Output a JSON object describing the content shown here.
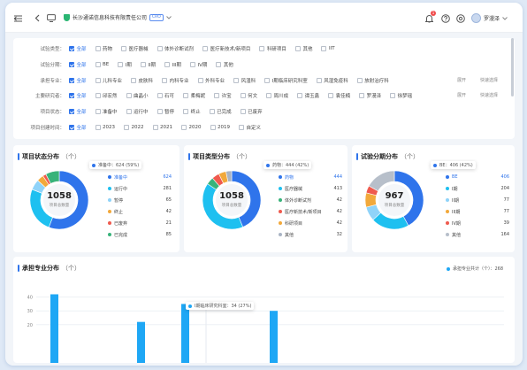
{
  "topbar": {
    "org_name": "长沙通诺信息科技有限责任公司",
    "org_badge": "CRO",
    "notification_count": "1",
    "user_name": "罗漫泽"
  },
  "filters": [
    {
      "label": "试验类型：",
      "options": [
        "全部",
        "药物",
        "医疗器械",
        "体外诊断试剂",
        "医疗新技术/新项目",
        "科研项目",
        "其他",
        "IIT"
      ]
    },
    {
      "label": "试验分期：",
      "options": [
        "全部",
        "BE",
        "I期",
        "II期",
        "III期",
        "IV期",
        "其他"
      ]
    },
    {
      "label": "承担专业：",
      "options": [
        "全部",
        "儿科专业",
        "皮肤科",
        "内科专业",
        "外科专业",
        "风湿科",
        "I期临床研究科室",
        "风湿免疫科",
        "放射治疗科"
      ],
      "expand": "展开",
      "quick": "快速选择"
    },
    {
      "label": "主要研究者：",
      "options": [
        "全部",
        "邱宏然",
        "曲晶小",
        "石可",
        "柔梅妮",
        "许宝",
        "何文",
        "周川成",
        "谭玉鑫",
        "袁佳楠",
        "罗漫泽",
        "徐梦瑶"
      ],
      "expand": "展开",
      "quick": "快速选择"
    },
    {
      "label": "项目状态：",
      "options": [
        "全部",
        "准备中",
        "运行中",
        "暂停",
        "终止",
        "已完成",
        "已废弃"
      ]
    },
    {
      "label": "项目创建时间：",
      "options": [
        "全部",
        "2023",
        "2022",
        "2021",
        "2020",
        "2019",
        "自定义"
      ]
    }
  ],
  "status_card": {
    "title": "项目状态分布",
    "unit": "（个）",
    "total": "1058",
    "total_label": "项目总数量",
    "tooltip": "准备中：624 (59%)",
    "colors": [
      "#2f74eb",
      "#1ec0f0",
      "#8fd3f9",
      "#f2a93b",
      "#ef5a4e",
      "#38b37a"
    ],
    "items": [
      {
        "name": "准备中",
        "value": "624",
        "n": 624
      },
      {
        "name": "运行中",
        "value": "281",
        "n": 281
      },
      {
        "name": "暂停",
        "value": "65",
        "n": 65
      },
      {
        "name": "终止",
        "value": "42",
        "n": 42
      },
      {
        "name": "已废弃",
        "value": "21",
        "n": 21
      },
      {
        "name": "已完成",
        "value": "85",
        "n": 85
      }
    ]
  },
  "type_card": {
    "title": "项目类型分布",
    "unit": "（个）",
    "total": "1058",
    "total_label": "项目总数量",
    "tooltip": "药物：444 (42%)",
    "colors": [
      "#2f74eb",
      "#1ec0f0",
      "#38b37a",
      "#ef5a4e",
      "#f2a93b",
      "#a9b4c4"
    ],
    "items": [
      {
        "name": "药物",
        "value": "444",
        "n": 444
      },
      {
        "name": "医疗器械",
        "value": "413",
        "n": 413
      },
      {
        "name": "体外诊断试剂",
        "value": "42",
        "n": 42
      },
      {
        "name": "医疗新技术/新项目",
        "value": "42",
        "n": 42
      },
      {
        "name": "科研项目",
        "value": "42",
        "n": 42
      },
      {
        "name": "其他",
        "value": "32",
        "n": 32
      }
    ]
  },
  "phase_card": {
    "title": "试验分期分布",
    "unit": "（个）",
    "total": "967",
    "total_label": "项目总数量",
    "tooltip": "BE：406 (42%)",
    "colors": [
      "#2f74eb",
      "#1ec0f0",
      "#8fd3f9",
      "#f2a93b",
      "#ef5a4e",
      "#b7bfca"
    ],
    "items": [
      {
        "name": "BE",
        "value": "406",
        "n": 406
      },
      {
        "name": "I期",
        "value": "204",
        "n": 204
      },
      {
        "name": "II期",
        "value": "77",
        "n": 77
      },
      {
        "name": "III期",
        "value": "77",
        "n": 77
      },
      {
        "name": "IV期",
        "value": "39",
        "n": 39
      },
      {
        "name": "其他",
        "value": "164",
        "n": 164
      }
    ]
  },
  "specialty_card": {
    "title": "承担专业分布",
    "unit": "（个）",
    "legend": "承担专业共计（个）：268",
    "tooltip": "I期临床研究科室：34 (27%)",
    "chart_data": {
      "type": "bar",
      "ylim": [
        0,
        50
      ],
      "yticks": [
        "40",
        "30",
        "20"
      ],
      "values": [
        42,
        22,
        35,
        30
      ]
    }
  }
}
